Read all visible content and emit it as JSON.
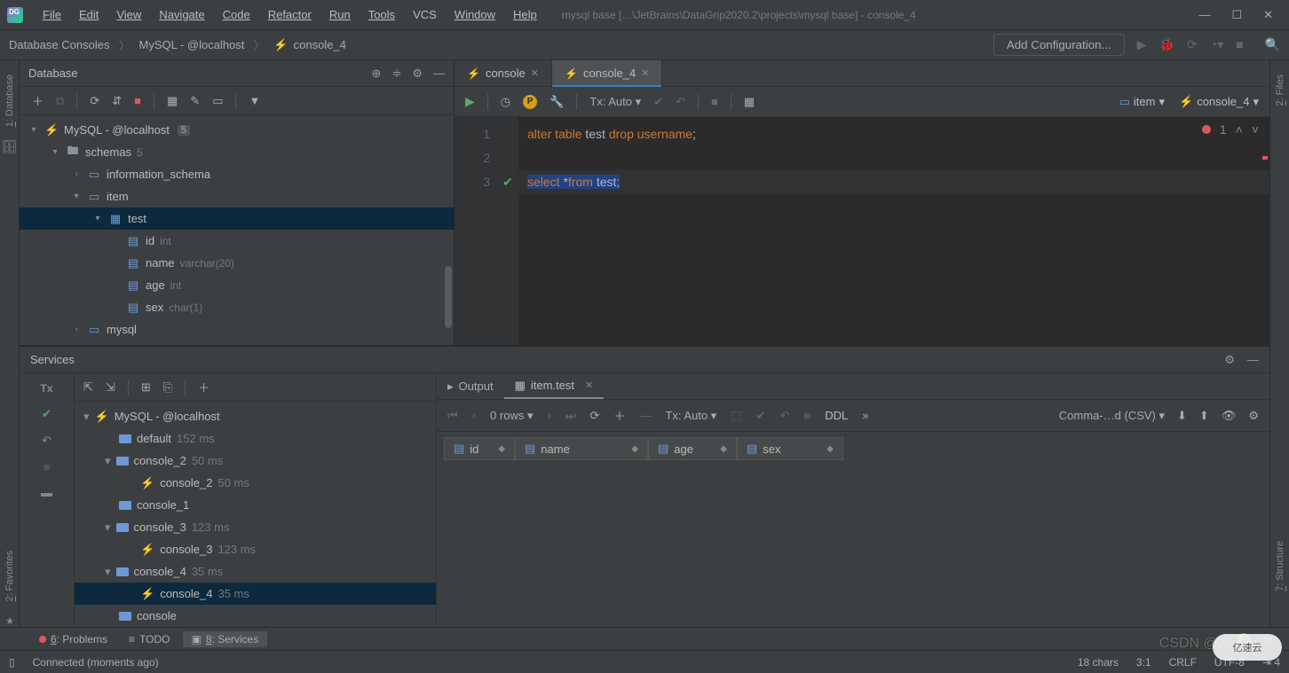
{
  "titlebar": {
    "menu": [
      "File",
      "Edit",
      "View",
      "Navigate",
      "Code",
      "Refactor",
      "Run",
      "Tools",
      "VCS",
      "Window",
      "Help"
    ],
    "title": "mysql base […\\JetBrains\\DataGrip2020.2\\projects\\mysql base] - console_4"
  },
  "breadcrumbs": [
    "Database Consoles",
    "MySQL - @localhost",
    "console_4"
  ],
  "toolbar": {
    "add_configuration": "Add Configuration..."
  },
  "database_panel": {
    "title": "Database",
    "tree": {
      "datasource": "MySQL - @localhost",
      "datasource_badge": "5",
      "schemas_label": "schemas",
      "schemas_count": "5",
      "schemas": [
        "information_schema",
        "item"
      ],
      "table": "test",
      "columns": [
        {
          "name": "id",
          "type": "int"
        },
        {
          "name": "name",
          "type": "varchar(20)"
        },
        {
          "name": "age",
          "type": "int"
        },
        {
          "name": "sex",
          "type": "char(1)"
        }
      ],
      "last_schema": "mysql"
    }
  },
  "editor": {
    "tabs": [
      {
        "label": "console",
        "active": false
      },
      {
        "label": "console_4",
        "active": true
      }
    ],
    "tx_mode": "Tx: Auto",
    "session_label": "item",
    "target_label": "console_4",
    "error_count": "1",
    "lines": {
      "l1": {
        "t1": "alter",
        "t2": "table",
        "t3": "test",
        "t4": "drop",
        "t5": "username",
        "t6": ";"
      },
      "l3": {
        "t1": "select",
        "t2": "*",
        "t3": "from",
        "t4": "test",
        "t5": ";"
      }
    }
  },
  "services": {
    "title": "Services",
    "tree": {
      "datasource": "MySQL - @localhost",
      "items": [
        {
          "label": "default",
          "time": "152 ms"
        },
        {
          "label": "console_2",
          "time": "50 ms",
          "children": [
            {
              "label": "console_2",
              "time": "50 ms"
            }
          ]
        },
        {
          "label": "console_1"
        },
        {
          "label": "console_3",
          "time": "123 ms",
          "children": [
            {
              "label": "console_3",
              "time": "123 ms"
            }
          ]
        },
        {
          "label": "console_4",
          "time": "35 ms",
          "children": [
            {
              "label": "console_4",
              "time": "35 ms"
            }
          ],
          "selected": true
        },
        {
          "label": "console"
        }
      ]
    },
    "result": {
      "tabs": [
        {
          "label": "Output"
        },
        {
          "label": "item.test",
          "active": true
        }
      ],
      "rows_label": "0 rows",
      "tx_mode": "Tx: Auto",
      "ddl": "DDL",
      "export": "Comma-…d (CSV)",
      "columns": [
        "id",
        "name",
        "age",
        "sex"
      ]
    }
  },
  "bottom_tabs": [
    {
      "icon": "error",
      "label": "6: Problems"
    },
    {
      "icon": "todo",
      "label": "TODO"
    },
    {
      "icon": "run",
      "label": "8: Services",
      "active": true
    }
  ],
  "status": {
    "left": "Connected (moments ago)",
    "chars": "18 chars",
    "pos": "3:1",
    "eol": "CRLF",
    "enc": "UTF-8",
    "sp": "4"
  },
  "watermark": "CSDN @weixin_4",
  "watermark2": "亿速云"
}
